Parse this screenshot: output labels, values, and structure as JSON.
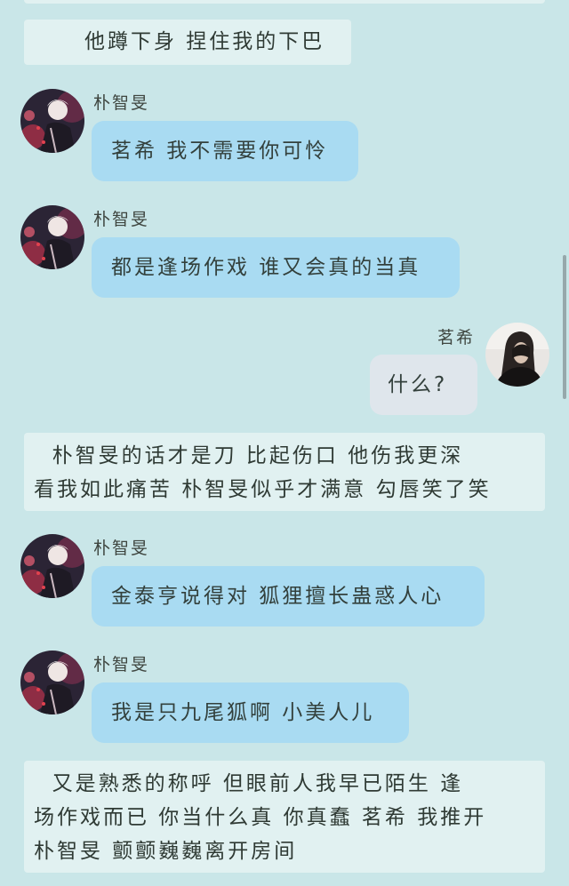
{
  "messages": {
    "narration_1": "他蹲下身 捏住我的下巴",
    "jimin_name": "朴智旻",
    "mingxi_name": "茗希",
    "msg_1": "茗希 我不需要你可怜",
    "msg_2": "都是逢场作戏 谁又会真的当真",
    "msg_3": "什么?",
    "narration_2": "  朴智旻的话才是刀 比起伤口 他伤我更深\n看我如此痛苦 朴智旻似乎才满意 勾唇笑了笑",
    "msg_4": "金泰亨说得对 狐狸擅长蛊惑人心",
    "msg_5": "我是只九尾狐啊 小美人儿",
    "narration_3": "  又是熟悉的称呼 但眼前人我早已陌生 逢\n场作戏而已 你当什么真 你真蠢 茗希 我推开\n朴智旻 颤颤巍巍离开房间"
  },
  "colors": {
    "background": "#c9e6e8",
    "narration_bg": "#e1f1f1",
    "left_bubble": "#a9dbf2",
    "right_bubble": "#dfe6ec"
  },
  "icons": {
    "jimin_avatar": "avatar-jimin",
    "mingxi_avatar": "avatar-mingxi"
  }
}
